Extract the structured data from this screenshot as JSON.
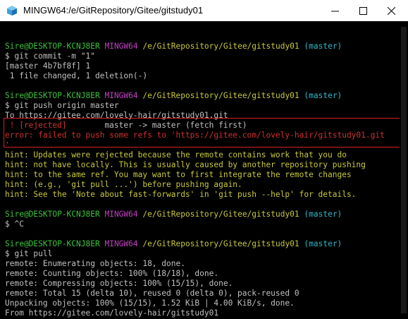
{
  "window": {
    "title": "MINGW64:/e/GitRepository/Gitee/gitstudy01"
  },
  "prompt": {
    "user_host": "Sire@DESKTOP-KCNJ8ER",
    "shell": "MINGW64",
    "path": "/e/GitRepository/Gitee/gitstudy01",
    "branch": "(master)"
  },
  "lines": {
    "l1_cmd": "$ git commit -m \"1\"",
    "l2": "[master 4b7bf8f] 1",
    "l3": " 1 file changed, 1 deletion(-)",
    "l5_cmd": "$ git push origin master",
    "l6": "To https://gitee.com/lovely-hair/gitstudy01.git",
    "l7_rejected": " ! [rejected]",
    "l7_rest": "        master -> master (fetch first)",
    "l8_error": "error: failed to push some refs to 'https://gitee.com/lovely-hair/gitstudy01.git",
    "l9_error": "'",
    "hint1": "hint: Updates were rejected because the remote contains work that you do",
    "hint2": "hint: not have locally. This is usually caused by another repository pushing",
    "hint3": "hint: to the same ref. You may want to first integrate the remote changes",
    "hint4": "hint: (e.g., 'git pull ...') before pushing again.",
    "hint5": "hint: See the 'Note about fast-forwards' in 'git push --help' for details.",
    "l_ctrlc": "$ ^C",
    "l_pull_cmd": "$ git pull",
    "r1": "remote: Enumerating objects: 18, done.",
    "r2": "remote: Counting objects: 100% (18/18), done.",
    "r3": "remote: Compressing objects: 100% (15/15), done.",
    "r4": "remote: Total 15 (delta 10), reused 0 (delta 0), pack-reused 0",
    "r5": "Unpacking objects: 100% (15/15), 1.52 KiB | 4.00 KiB/s, done.",
    "r6": "From https://gitee.com/lovely-hair/gitstudy01"
  },
  "colors": {
    "prompt_user": "#3bc23b",
    "prompt_shell": "#c040c0",
    "prompt_path": "#c8c83c",
    "prompt_branch": "#2fb8c8",
    "error": "#d03030",
    "highlight_border": "#d82020"
  },
  "icons": {
    "app": "mingw-app-icon",
    "minimize": "minimize-icon",
    "maximize": "maximize-icon",
    "close": "close-icon"
  }
}
